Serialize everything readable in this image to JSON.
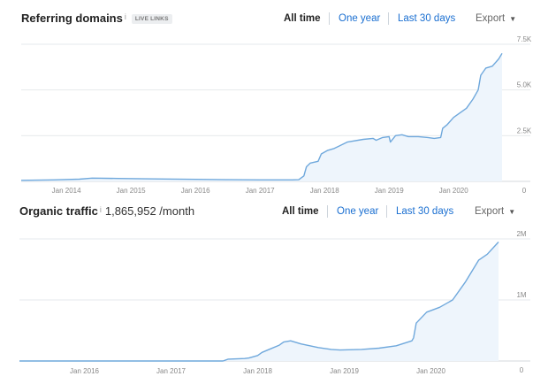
{
  "charts": {
    "referring_domains": {
      "title": "Referring domains",
      "info_icon": "i",
      "badge": "LIVE LINKS",
      "range_buttons": [
        "All time",
        "One year",
        "Last 30 days"
      ],
      "export_label": "Export",
      "caret_icon": "chevron-down-icon"
    },
    "organic_traffic": {
      "title": "Organic traffic",
      "info_icon": "i",
      "value": "1,865,952 /month",
      "range_buttons": [
        "All time",
        "One year",
        "Last 30 days"
      ],
      "export_label": "Export",
      "caret_icon": "chevron-down-icon"
    }
  },
  "colors": {
    "line": "#6fa8dc",
    "fill": "#eef5fc",
    "grid": "#e6e9ec",
    "link": "#1a6fd1"
  },
  "chart_data": [
    {
      "type": "area",
      "title": "Referring domains",
      "xlim": [
        2013.3,
        2020.75
      ],
      "ylim": [
        0,
        7500
      ],
      "y_ticks": [
        0,
        2500,
        5000,
        7500
      ],
      "y_tick_labels": [
        "0",
        "2.5K",
        "5.0K",
        "7.5K"
      ],
      "x_tick_labels": [
        "Jan 2014",
        "Jan 2015",
        "Jan 2016",
        "Jan 2017",
        "Jan 2018",
        "Jan 2019",
        "Jan 2020"
      ],
      "x_ticks": [
        2014,
        2015,
        2016,
        2017,
        2018,
        2019,
        2020
      ],
      "grid": true,
      "series": [
        {
          "x": [
            2013.3,
            2013.8,
            2014.2,
            2014.4,
            2014.8,
            2015.5,
            2016.0,
            2016.5,
            2017.0,
            2017.5,
            2017.6,
            2017.68,
            2017.72,
            2017.78,
            2017.9,
            2017.95,
            2018.05,
            2018.15,
            2018.35,
            2018.6,
            2018.75,
            2018.8,
            2018.9,
            2019.0,
            2019.02,
            2019.1,
            2019.2,
            2019.3,
            2019.45,
            2019.6,
            2019.7,
            2019.8,
            2019.83,
            2019.9,
            2020.0,
            2020.2,
            2020.3,
            2020.38,
            2020.42,
            2020.5,
            2020.6,
            2020.7,
            2020.75
          ],
          "y": [
            60,
            80,
            120,
            180,
            160,
            130,
            110,
            90,
            80,
            80,
            90,
            300,
            800,
            1000,
            1100,
            1500,
            1700,
            1800,
            2150,
            2300,
            2350,
            2250,
            2400,
            2450,
            2150,
            2500,
            2550,
            2450,
            2450,
            2400,
            2350,
            2400,
            2900,
            3100,
            3500,
            4000,
            4500,
            5000,
            5800,
            6200,
            6300,
            6700,
            7000
          ]
        }
      ]
    },
    {
      "type": "area",
      "title": "Organic traffic",
      "xlim": [
        2015.25,
        2020.78
      ],
      "ylim": [
        0,
        2000000
      ],
      "y_ticks": [
        0,
        1000000,
        2000000
      ],
      "y_tick_labels": [
        "0",
        "1M",
        "2M"
      ],
      "x_tick_labels": [
        "Jan 2016",
        "Jan 2017",
        "Jan 2018",
        "Jan 2019",
        "Jan 2020"
      ],
      "x_ticks": [
        2016,
        2017,
        2018,
        2019,
        2020
      ],
      "grid": true,
      "series": [
        {
          "x": [
            2015.25,
            2017.6,
            2017.62,
            2017.66,
            2017.85,
            2017.9,
            2018.0,
            2018.05,
            2018.15,
            2018.25,
            2018.3,
            2018.38,
            2018.5,
            2018.7,
            2018.85,
            2018.95,
            2019.2,
            2019.4,
            2019.6,
            2019.78,
            2019.8,
            2019.83,
            2019.95,
            2020.1,
            2020.25,
            2020.4,
            2020.55,
            2020.65,
            2020.78
          ],
          "y": [
            0,
            0,
            10000,
            30000,
            40000,
            50000,
            90000,
            140000,
            200000,
            260000,
            310000,
            330000,
            280000,
            220000,
            190000,
            180000,
            190000,
            210000,
            250000,
            330000,
            380000,
            620000,
            800000,
            880000,
            1000000,
            1300000,
            1650000,
            1750000,
            1950000
          ]
        }
      ]
    }
  ]
}
